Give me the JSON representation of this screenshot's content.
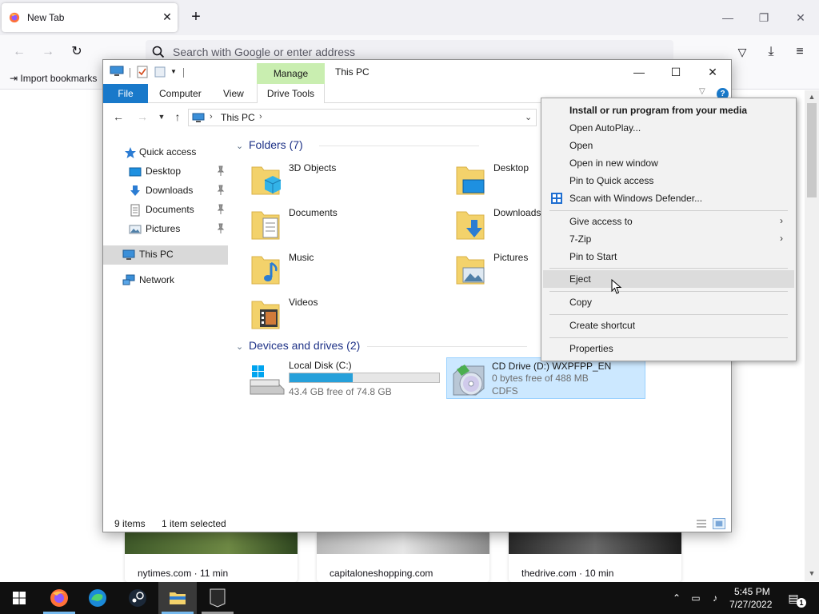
{
  "browser": {
    "tab_title": "New Tab",
    "url_placeholder": "Search with Google or enter address",
    "bookmark_import": "Import bookmarks"
  },
  "stories": [
    {
      "caption": "nytimes.com · 11 min"
    },
    {
      "caption": "capitaloneshopping.com"
    },
    {
      "caption": "thedrive.com · 10 min"
    }
  ],
  "explorer": {
    "title": "This PC",
    "manage_tab": "Manage",
    "ribbon": {
      "file": "File",
      "computer": "Computer",
      "view": "View",
      "drive_tools": "Drive Tools"
    },
    "address_label": "This PC",
    "nav": {
      "quick_access": "Quick access",
      "desktop": "Desktop",
      "downloads": "Downloads",
      "documents": "Documents",
      "pictures": "Pictures",
      "this_pc": "This PC",
      "network": "Network"
    },
    "folders_header": "Folders (7)",
    "folders": [
      {
        "label": "3D Objects"
      },
      {
        "label": "Desktop"
      },
      {
        "label": "Documents"
      },
      {
        "label": "Downloads"
      },
      {
        "label": "Music"
      },
      {
        "label": "Pictures"
      },
      {
        "label": "Videos"
      }
    ],
    "devices_header": "Devices and drives (2)",
    "drives": [
      {
        "name": "Local Disk (C:)",
        "free": "43.4 GB free of 74.8 GB",
        "used_fraction": 0.42
      },
      {
        "name": "CD Drive (D:) WXPFPP_EN",
        "free": "0 bytes free of 488 MB",
        "fs": "CDFS"
      }
    ],
    "status_count": "9 items",
    "status_selected": "1 item selected"
  },
  "context_menu": {
    "items": [
      {
        "label": "Install or run program from your media",
        "bold": true
      },
      {
        "label": "Open AutoPlay..."
      },
      {
        "label": "Open"
      },
      {
        "label": "Open in new window"
      },
      {
        "label": "Pin to Quick access"
      },
      {
        "label": "Scan with Windows Defender..."
      },
      {
        "label": "Give access to",
        "submenu": true
      },
      {
        "label": "7-Zip",
        "submenu": true
      },
      {
        "label": "Pin to Start"
      },
      {
        "label": "Eject",
        "hovered": true
      },
      {
        "label": "Copy"
      },
      {
        "label": "Create shortcut"
      },
      {
        "label": "Properties"
      }
    ]
  },
  "taskbar": {
    "time": "5:45 PM",
    "date": "7/27/2022",
    "notification_count": "1"
  },
  "colors": {
    "accent": "#1979ca",
    "manage_tab": "#c9eeb0",
    "selection": "#cce8ff",
    "drive_bar": "#26a0da",
    "taskbar": "#101010"
  }
}
